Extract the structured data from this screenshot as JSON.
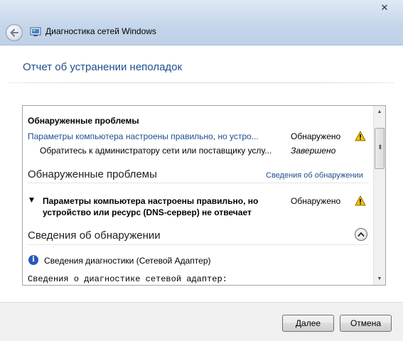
{
  "window": {
    "title": "Диагностика сетей Windows",
    "close_glyph": "✕"
  },
  "header": {
    "page_title": "Отчет об устранении неполадок"
  },
  "summary": {
    "heading": "Обнаруженные проблемы",
    "rows": [
      {
        "text": "Параметры компьютера настроены правильно, но устро...",
        "status": "Обнаружено",
        "icon": "warning-icon"
      },
      {
        "text": "Обратитесь к администратору сети или поставщику услу...",
        "status": "Завершено",
        "icon": ""
      }
    ]
  },
  "problems_section": {
    "heading": "Обнаруженные проблемы",
    "details_link": "Сведения об обнаружении",
    "problem_line1": "Параметры компьютера настроены правильно, но",
    "problem_line2": "устройство или ресурс (DNS-сервер) не отвечает",
    "problem_status": "Обнаружено",
    "expand_glyph": "▼"
  },
  "detection_section": {
    "heading": "Сведения об обнаружении",
    "info_label": "Сведения диагностики (Сетевой Адаптер)",
    "mono_line": "Сведения о диагностике сетевой адаптер:",
    "info_glyph": "i"
  },
  "scrollbar": {
    "up_glyph": "▲",
    "down_glyph": "▼",
    "grip_glyph": "⬍"
  },
  "footer": {
    "next_label": "Далее",
    "cancel_label": "Отмена"
  },
  "colors": {
    "link": "#1e4e8c",
    "title_blue": "#1e4e8c",
    "warning_yellow": "#f5c400"
  }
}
